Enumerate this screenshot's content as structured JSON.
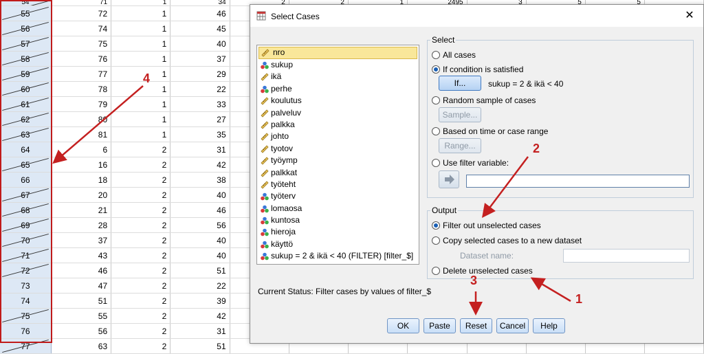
{
  "grid": {
    "first_row": {
      "id": "54",
      "c1": "71",
      "c2": "1",
      "c3": "34",
      "c4": "2",
      "c5": "2",
      "c6": "1",
      "c7": "2495",
      "c8": "3",
      "c9": "5",
      "c10": "5"
    },
    "rows": [
      {
        "id": "55",
        "c1": "72",
        "c2": "1",
        "c3": "46",
        "excluded": true
      },
      {
        "id": "56",
        "c1": "74",
        "c2": "1",
        "c3": "45",
        "excluded": true
      },
      {
        "id": "57",
        "c1": "75",
        "c2": "1",
        "c3": "40",
        "excluded": true
      },
      {
        "id": "58",
        "c1": "76",
        "c2": "1",
        "c3": "37",
        "excluded": true
      },
      {
        "id": "59",
        "c1": "77",
        "c2": "1",
        "c3": "29",
        "excluded": true
      },
      {
        "id": "60",
        "c1": "78",
        "c2": "1",
        "c3": "22",
        "excluded": true
      },
      {
        "id": "61",
        "c1": "79",
        "c2": "1",
        "c3": "33",
        "excluded": true
      },
      {
        "id": "62",
        "c1": "80",
        "c2": "1",
        "c3": "27",
        "excluded": true
      },
      {
        "id": "63",
        "c1": "81",
        "c2": "1",
        "c3": "35",
        "excluded": true
      },
      {
        "id": "64",
        "c1": "6",
        "c2": "2",
        "c3": "31",
        "excluded": false
      },
      {
        "id": "65",
        "c1": "16",
        "c2": "2",
        "c3": "42",
        "excluded": true
      },
      {
        "id": "66",
        "c1": "18",
        "c2": "2",
        "c3": "38",
        "excluded": false
      },
      {
        "id": "67",
        "c1": "20",
        "c2": "2",
        "c3": "40",
        "excluded": true
      },
      {
        "id": "68",
        "c1": "21",
        "c2": "2",
        "c3": "46",
        "excluded": true
      },
      {
        "id": "69",
        "c1": "28",
        "c2": "2",
        "c3": "56",
        "excluded": true
      },
      {
        "id": "70",
        "c1": "37",
        "c2": "2",
        "c3": "40",
        "excluded": true
      },
      {
        "id": "71",
        "c1": "43",
        "c2": "2",
        "c3": "40",
        "excluded": true
      },
      {
        "id": "72",
        "c1": "46",
        "c2": "2",
        "c3": "51",
        "excluded": true
      },
      {
        "id": "73",
        "c1": "47",
        "c2": "2",
        "c3": "22",
        "excluded": false
      },
      {
        "id": "74",
        "c1": "51",
        "c2": "2",
        "c3": "39",
        "excluded": false
      },
      {
        "id": "75",
        "c1": "55",
        "c2": "2",
        "c3": "42",
        "excluded": true
      },
      {
        "id": "76",
        "c1": "56",
        "c2": "2",
        "c3": "31",
        "excluded": false
      },
      {
        "id": "77",
        "c1": "63",
        "c2": "2",
        "c3": "51",
        "excluded": true
      }
    ]
  },
  "dialog": {
    "title": "Select Cases",
    "variables": [
      {
        "name": "nro",
        "icon": "scale-icon",
        "selected": true
      },
      {
        "name": "sukup",
        "icon": "nominal-icon"
      },
      {
        "name": "ikä",
        "icon": "scale-icon"
      },
      {
        "name": "perhe",
        "icon": "nominal-icon"
      },
      {
        "name": "koulutus",
        "icon": "scale-icon"
      },
      {
        "name": "palveluv",
        "icon": "scale-icon"
      },
      {
        "name": "palkka",
        "icon": "scale-icon"
      },
      {
        "name": "johto",
        "icon": "scale-icon"
      },
      {
        "name": "tyotov",
        "icon": "scale-icon"
      },
      {
        "name": "työymp",
        "icon": "scale-icon"
      },
      {
        "name": "palkkat",
        "icon": "scale-icon"
      },
      {
        "name": "työteht",
        "icon": "scale-icon"
      },
      {
        "name": "työterv",
        "icon": "nominal-icon"
      },
      {
        "name": "lomaosa",
        "icon": "nominal-icon"
      },
      {
        "name": "kuntosa",
        "icon": "nominal-icon"
      },
      {
        "name": "hieroja",
        "icon": "nominal-icon"
      },
      {
        "name": "käyttö",
        "icon": "nominal-icon"
      },
      {
        "name": "sukup = 2 & ikä < 40 (FILTER) [filter_$]",
        "icon": "nominal-icon"
      }
    ],
    "select_group": {
      "legend": "Select",
      "all_cases": "All cases",
      "if_condition": "If condition is satisfied",
      "if_button": "If...",
      "condition": "sukup = 2 & ikä < 40",
      "random_sample": "Random sample of cases",
      "sample_button": "Sample...",
      "based_on_time": "Based on time or case range",
      "range_button": "Range...",
      "use_filter": "Use filter variable:"
    },
    "output_group": {
      "legend": "Output",
      "filter_out": "Filter out unselected cases",
      "copy_selected": "Copy selected cases to a new dataset",
      "dataset_name_label": "Dataset name:",
      "delete_unselected": "Delete unselected cases"
    },
    "status": "Current Status: Filter cases by values of filter_$",
    "buttons": {
      "ok": "OK",
      "paste": "Paste",
      "reset": "Reset",
      "cancel": "Cancel",
      "help": "Help"
    }
  },
  "annotations": {
    "n1": "1",
    "n2": "2",
    "n3": "3",
    "n4": "4"
  },
  "colors": {
    "annotation_red": "#c42020",
    "selected_radio": "#1a5fb4",
    "row_header": "#dde8f5"
  }
}
